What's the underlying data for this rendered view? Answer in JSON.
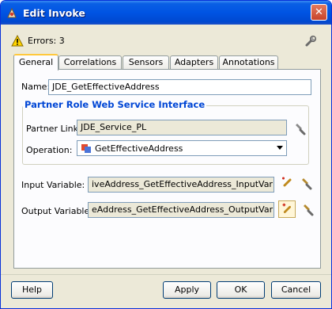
{
  "window": {
    "title": "Edit Invoke",
    "close_glyph": "✕"
  },
  "errors": {
    "text": "Errors: 3"
  },
  "tabs": [
    {
      "label": "General"
    },
    {
      "label": "Correlations"
    },
    {
      "label": "Sensors"
    },
    {
      "label": "Adapters"
    },
    {
      "label": "Annotations"
    }
  ],
  "general": {
    "name_label": "Name:",
    "name_value": "JDE_GetEffectiveAddress",
    "group_title": "Partner Role Web Service Interface",
    "partner_link_label": "Partner Link:",
    "partner_link_value": "JDE_Service_PL",
    "operation_label": "Operation:",
    "operation_value": "GetEffectiveAddress",
    "input_variable_label": "Input Variable:",
    "input_variable_value": "iveAddress_GetEffectiveAddress_InputVariable",
    "output_variable_label": "Output Variable:",
    "output_variable_value": "eAddress_GetEffectiveAddress_OutputVariable"
  },
  "buttons": {
    "help": "Help",
    "apply": "Apply",
    "ok": "OK",
    "cancel": "Cancel"
  },
  "icons": {
    "app": "duke-icon",
    "warning": "warning-icon",
    "settings": "wrench-icon",
    "browse": "flashlight-icon",
    "create": "add-variable-icon",
    "operation": "operation-icon"
  },
  "colors": {
    "accent": "#0054e3",
    "group_title": "#0046d5",
    "tab_active": "#ffc83c"
  }
}
